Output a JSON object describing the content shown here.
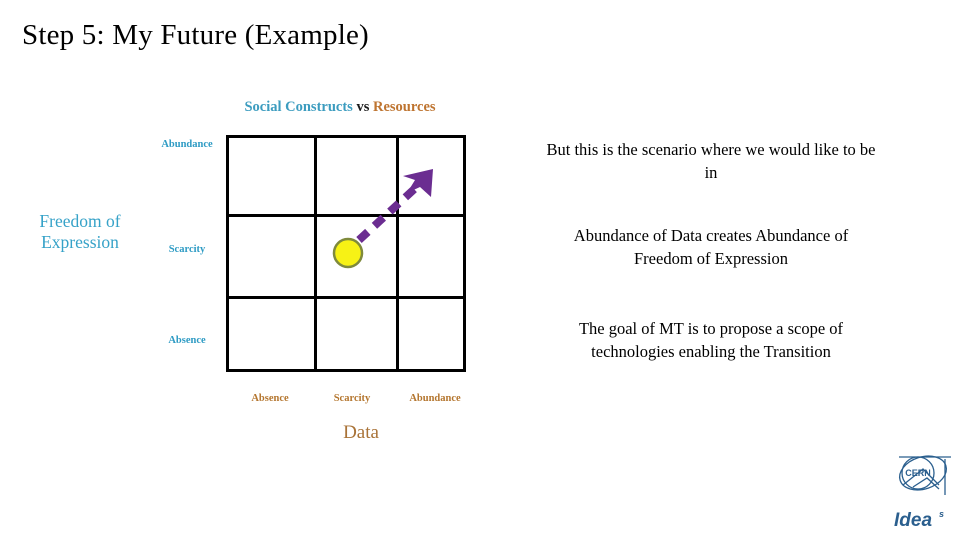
{
  "slide": {
    "title": "Step 5: My Future (Example)",
    "background_color": "#FFFFFF"
  },
  "chart_data": {
    "type": "scatter",
    "title_segments": {
      "left": "Social Constructs",
      "middle": "vs",
      "right": "Resources"
    },
    "title": "Social Constructs vs Resources",
    "xlabel": "Data",
    "ylabel": "Freedom of Expression",
    "x_tick_labels": [
      "Absence",
      "Scarcity",
      "Abundance"
    ],
    "y_tick_labels": [
      "Absence",
      "Scarcity",
      "Abundance"
    ],
    "grid": true,
    "grid_rows": 3,
    "grid_cols": 3,
    "xlim": [
      0,
      3
    ],
    "ylim": [
      0,
      3
    ],
    "axis_colors": {
      "x": "#B4762F",
      "y": "#2E9BC4",
      "x_title": "#A97338",
      "y_title": "#36A2C8"
    },
    "points": [
      {
        "label": "current-state",
        "x": "Scarcity",
        "y": "Scarcity",
        "x_value": 1.5,
        "y_value": 1.5,
        "fill": "#F7F215",
        "stroke": "#7F8A3C",
        "radius": 14
      }
    ],
    "annotations": [
      {
        "type": "arrow",
        "style": "dashed",
        "color": "#6B2D91",
        "from": {
          "x_value": 1.62,
          "y_value": 1.62
        },
        "to": {
          "x_value": 2.55,
          "y_value": 2.6
        },
        "direction": "up-right",
        "meaning": "transition toward abundance"
      }
    ]
  },
  "notes": {
    "note_1": "But this is the scenario where we would like to be in",
    "note_2": "Abundance of Data creates Abundance of Freedom of Expression",
    "note_3": "The goal of MT is to propose a scope of technologies enabling the Transition"
  },
  "logos": {
    "cern": "CERN",
    "ideas": "Idea",
    "ideas_superscript": "s"
  }
}
